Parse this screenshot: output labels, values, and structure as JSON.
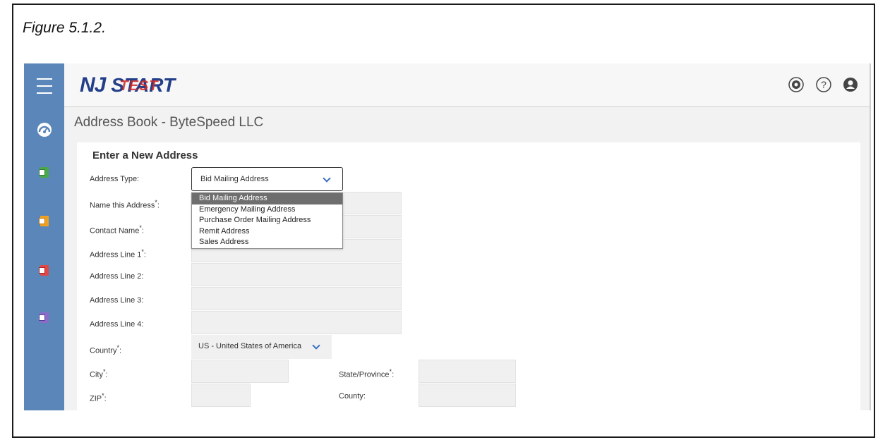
{
  "caption": "Figure 5.1.2.",
  "logo": {
    "nj": "NJ",
    "start": "START",
    "test": "TEST"
  },
  "header_icons": [
    "gear-icon",
    "help-icon",
    "user-icon"
  ],
  "page_title": "Address Book - ByteSpeed LLC",
  "form": {
    "title": "Enter a New Address",
    "address_type_label": "Address Type:",
    "address_type_value": "Bid Mailing Address",
    "address_type_options": [
      "Bid Mailing Address",
      "Emergency Mailing Address",
      "Purchase Order Mailing Address",
      "Remit Address",
      "Sales Address"
    ],
    "name_label": "Name this Address",
    "contact_label": "Contact Name",
    "line1_label": "Address Line 1",
    "line2_label": "Address Line 2:",
    "line3_label": "Address Line 3:",
    "line4_label": "Address Line 4:",
    "country_label": "Country",
    "country_value": "US - United States of America",
    "city_label": "City",
    "state_label": "State/Province",
    "zip_label": "ZIP",
    "county_label": "County:",
    "required_mark": "*",
    "colon": ":"
  },
  "colors": {
    "sidebar": "#5b86b9",
    "accent": "#3b6fc0",
    "selected_option": "#6e6e6e"
  }
}
